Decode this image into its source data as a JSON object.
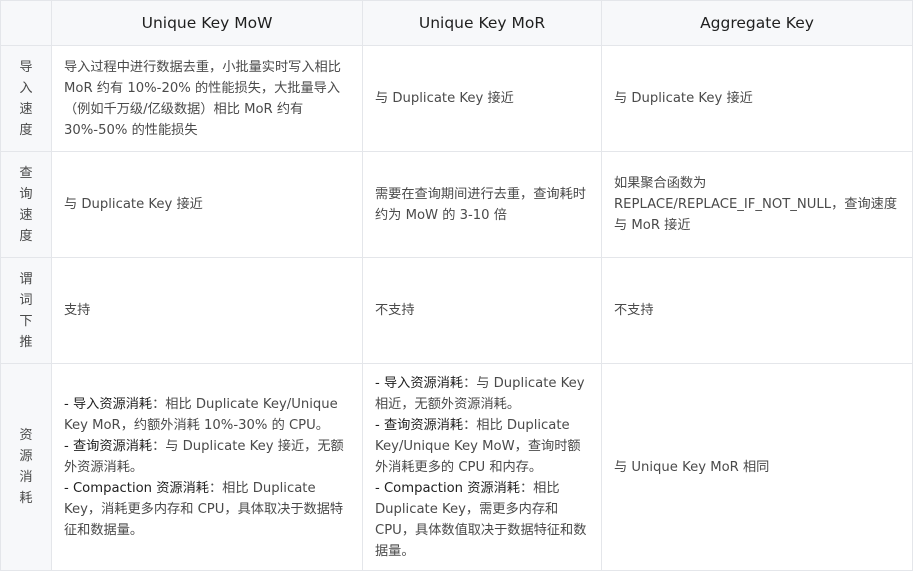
{
  "table": {
    "headers": [
      "",
      "Unique Key MoW",
      "Unique Key MoR",
      "Aggregate Key"
    ],
    "rows": [
      {
        "label": "导入速度",
        "cells": [
          "导入过程中进行数据去重，小批量实时写入相比 MoR 约有 10%-20% 的性能损失，大批量导入（例如千万级/亿级数据）相比 MoR 约有 30%-50% 的性能损失",
          "与 Duplicate Key 接近",
          "与 Duplicate Key 接近"
        ]
      },
      {
        "label": "查询速度",
        "cells": [
          "与 Duplicate Key 接近",
          "需要在查询期间进行去重，查询耗时约为 MoW 的 3-10 倍",
          "如果聚合函数为 REPLACE/REPLACE_IF_NOT_NULL，查询速度与 MoR 接近"
        ]
      },
      {
        "label": "谓词下推",
        "cells": [
          "支持",
          "不支持",
          "不支持"
        ]
      },
      {
        "label": "资源消耗",
        "cells": [
          [
            {
              "key": "- 导入资源消耗",
              "text": "：相比 Duplicate Key/Unique Key MoR，约额外消耗 10%-30% 的 CPU。"
            },
            {
              "key": "- 查询资源消耗",
              "text": "：与 Duplicate Key 接近，无额外资源消耗。"
            },
            {
              "key": "- Compaction 资源消耗",
              "text": "：相比 Duplicate Key，消耗更多内存和 CPU，具体取决于数据特征和数据量。"
            }
          ],
          [
            {
              "key": "- 导入资源消耗",
              "text": "：与 Duplicate Key 相近，无额外资源消耗。"
            },
            {
              "key": "- 查询资源消耗",
              "text": "：相比 Duplicate Key/Unique Key MoW，查询时额外消耗更多的 CPU 和内存。"
            },
            {
              "key": "- Compaction 资源消耗",
              "text": "：相比 Duplicate Key，需更多内存和 CPU，具体数值取决于数据特征和数据量。"
            }
          ],
          "与 Unique Key MoR 相同"
        ]
      }
    ]
  }
}
